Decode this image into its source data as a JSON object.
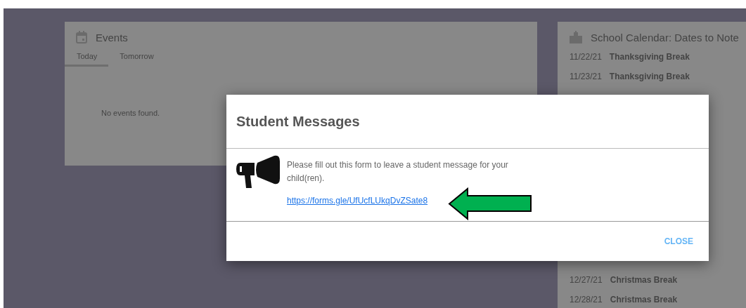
{
  "events": {
    "title": "Events",
    "tabs": [
      {
        "label": "Today",
        "selected": true
      },
      {
        "label": "Tomorrow",
        "selected": false
      }
    ],
    "empty_text": "No events found."
  },
  "school_calendar": {
    "title": "School Calendar: Dates to Note",
    "items_top": [
      {
        "date": "11/22/21",
        "name": "Thanksgiving Break"
      },
      {
        "date": "11/23/21",
        "name": "Thanksgiving Break"
      }
    ],
    "items_bottom": [
      {
        "date": "12/27/21",
        "name": "Christmas Break"
      },
      {
        "date": "12/28/21",
        "name": "Christmas Break"
      }
    ]
  },
  "dialog": {
    "title": "Student Messages",
    "message": "Please fill out this form to leave a student message for your child(ren).",
    "link": "https://forms.gle/UfUcfLUkqDvZSate8",
    "close_button": "CLOSE"
  }
}
